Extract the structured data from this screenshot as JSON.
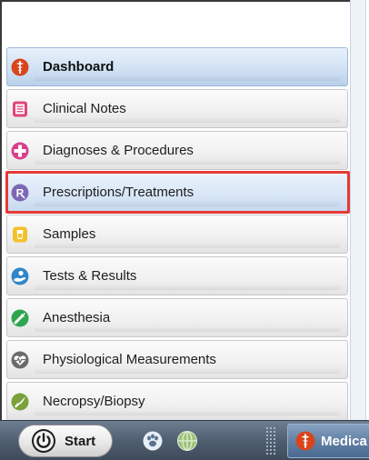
{
  "nav": {
    "items": [
      {
        "label": "Dashboard",
        "icon": "caduceus-icon"
      },
      {
        "label": "Clinical Notes",
        "icon": "notes-icon"
      },
      {
        "label": "Diagnoses & Procedures",
        "icon": "medical-cross-icon"
      },
      {
        "label": "Prescriptions/Treatments",
        "icon": "rx-icon"
      },
      {
        "label": "Samples",
        "icon": "sample-cup-icon"
      },
      {
        "label": "Tests & Results",
        "icon": "hand-test-icon"
      },
      {
        "label": "Anesthesia",
        "icon": "syringe-icon"
      },
      {
        "label": "Physiological Measurements",
        "icon": "heartbeat-icon"
      },
      {
        "label": "Necropsy/Biopsy",
        "icon": "scalpel-icon"
      }
    ],
    "active_item": "Dashboard",
    "highlighted_item": "Prescriptions/Treatments"
  },
  "taskbar": {
    "start_label": "Start",
    "task_label": "Medica",
    "tray_icons": [
      "paw-icon",
      "globe-icon"
    ]
  },
  "colors": {
    "highlight_box": "#e53935",
    "active_item_bg": "#cfe0f3",
    "taskbar_bg": "#4f5e70"
  }
}
